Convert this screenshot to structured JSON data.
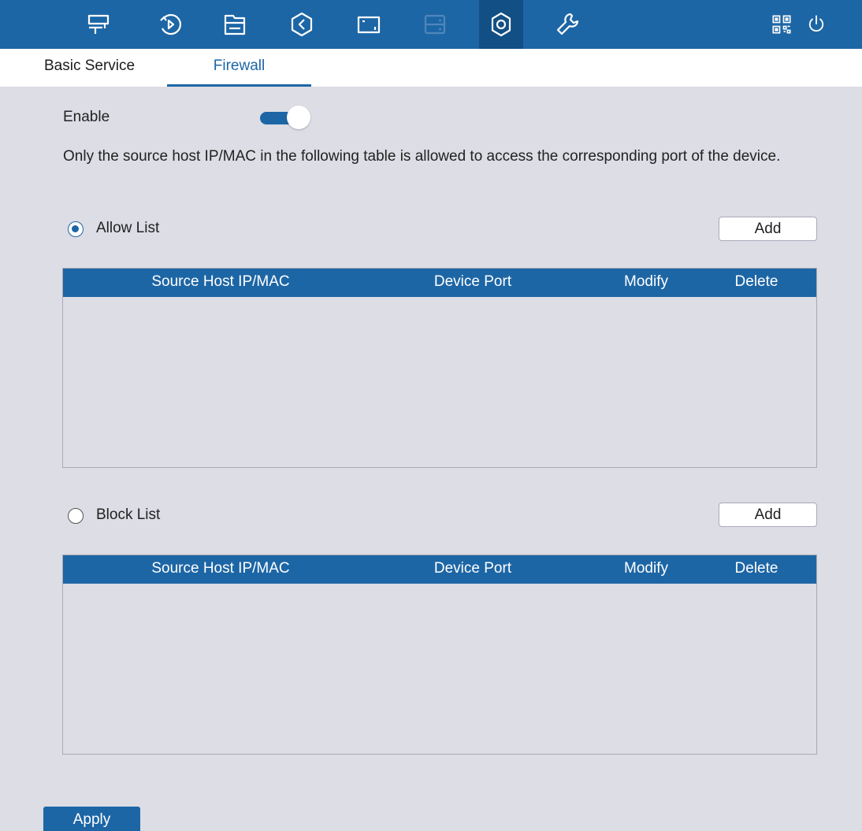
{
  "topnav": {
    "items": [
      {
        "name": "live-view-icon"
      },
      {
        "name": "playback-icon"
      },
      {
        "name": "file-management-icon"
      },
      {
        "name": "smart-icon"
      },
      {
        "name": "camera-icon"
      },
      {
        "name": "storage-icon"
      },
      {
        "name": "settings-icon",
        "active": true
      },
      {
        "name": "maintenance-icon"
      }
    ],
    "right": [
      {
        "name": "qr-code-icon"
      },
      {
        "name": "power-icon"
      }
    ]
  },
  "tabs": {
    "basic_service": "Basic Service",
    "firewall": "Firewall",
    "active": "Firewall"
  },
  "firewall": {
    "enable_label": "Enable",
    "enabled": true,
    "description": "Only the source host IP/MAC in the following table is allowed to access the corresponding port of the device.",
    "allow_list": {
      "label": "Allow List",
      "selected": true,
      "add_label": "Add",
      "columns": [
        "Source Host IP/MAC",
        "Device Port",
        "Modify",
        "Delete"
      ],
      "rows": []
    },
    "block_list": {
      "label": "Block List",
      "selected": false,
      "add_label": "Add",
      "columns": [
        "Source Host IP/MAC",
        "Device Port",
        "Modify",
        "Delete"
      ],
      "rows": []
    }
  },
  "apply_label": "Apply",
  "colors": {
    "accent": "#1d66a5",
    "accent_active": "#124f84",
    "background": "#dcdde5",
    "panel": "#ffffff"
  }
}
